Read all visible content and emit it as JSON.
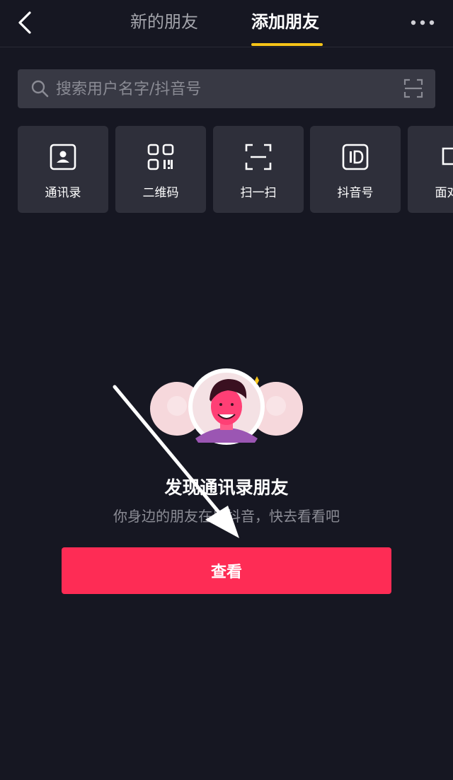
{
  "header": {
    "tabs": [
      {
        "label": "新的朋友"
      },
      {
        "label": "添加朋友"
      }
    ]
  },
  "search": {
    "placeholder": "搜索用户名字/抖音号",
    "value": ""
  },
  "quick_actions": [
    {
      "label": "通讯录",
      "icon": "contacts-icon"
    },
    {
      "label": "二维码",
      "icon": "qr-code-icon"
    },
    {
      "label": "扫一扫",
      "icon": "scan-icon"
    },
    {
      "label": "抖音号",
      "icon": "id-icon"
    },
    {
      "label": "面对面",
      "icon": "face-to-face-icon"
    }
  ],
  "empty_state": {
    "title": "发现通讯录朋友",
    "subtitle": "你身边的朋友在用抖音，快去看看吧",
    "button_label": "查看"
  },
  "colors": {
    "background": "#161722",
    "accent": "#fe2c55",
    "tab_indicator": "#f6c418"
  }
}
